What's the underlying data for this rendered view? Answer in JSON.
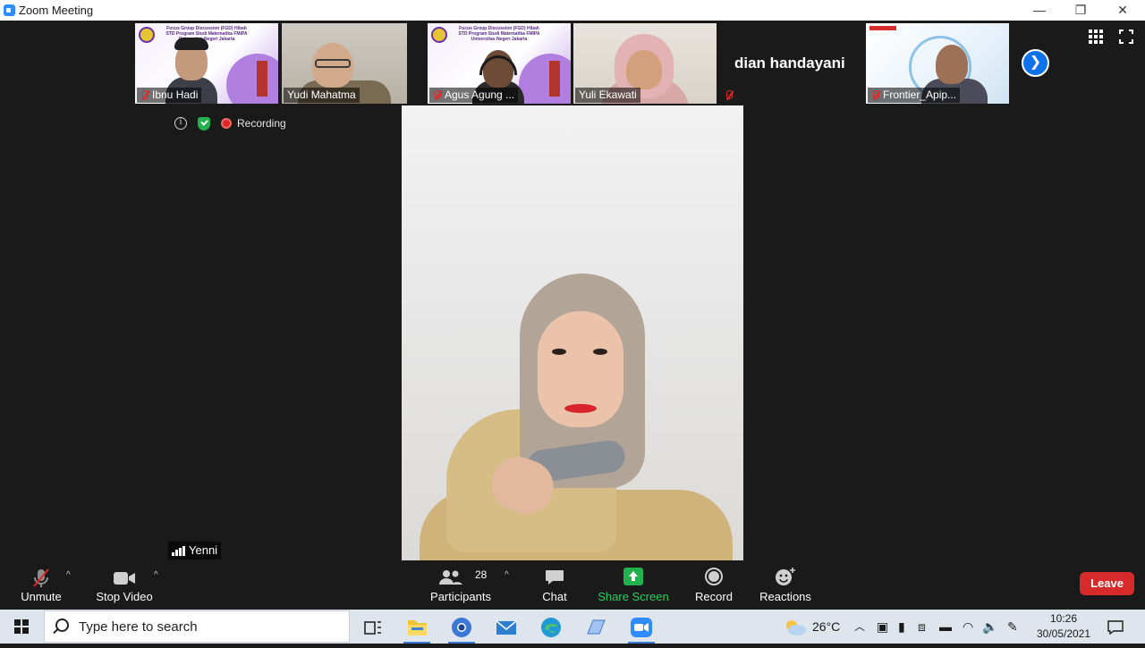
{
  "window": {
    "title": "Zoom Meeting",
    "controls": {
      "minimize": "—",
      "restore": "❐",
      "close": "✕"
    }
  },
  "participants_strip": [
    {
      "name": "Ibnu Hadi",
      "muted": true,
      "slide_text": "Focus Group Discussion (FGD) Hibah STD Program Studi Matematika FMIPA Universitas Negeri Jakarta"
    },
    {
      "name": "Yudi Mahatma",
      "muted": false
    },
    {
      "name": "Agus Agung ...",
      "muted": true,
      "slide_text": "Focus Group Discussion (FGD) Hibah STD Program Studi Matematika FMIPA Universitas Negeri Jakarta"
    },
    {
      "name": "Yuli Ekawati",
      "muted": false
    },
    {
      "name": "dian handayani",
      "muted": true
    },
    {
      "name": "Frontier_Apip...",
      "muted": true
    }
  ],
  "status": {
    "recording_label": "Recording"
  },
  "active_speaker": {
    "name": "Yenni"
  },
  "toolbar": {
    "unmute": "Unmute",
    "stop_video": "Stop Video",
    "participants": "Participants",
    "participants_count": "28",
    "chat": "Chat",
    "share_screen": "Share Screen",
    "record": "Record",
    "reactions": "Reactions",
    "leave": "Leave"
  },
  "taskbar": {
    "search_placeholder": "Type here to search",
    "weather_temp": "26°C",
    "time": "10:26",
    "date": "30/05/2021"
  },
  "colors": {
    "accent_blue": "#0e72ed",
    "share_green": "#23b14d",
    "leave_red": "#d72a2a",
    "muted_red": "#e02828"
  }
}
